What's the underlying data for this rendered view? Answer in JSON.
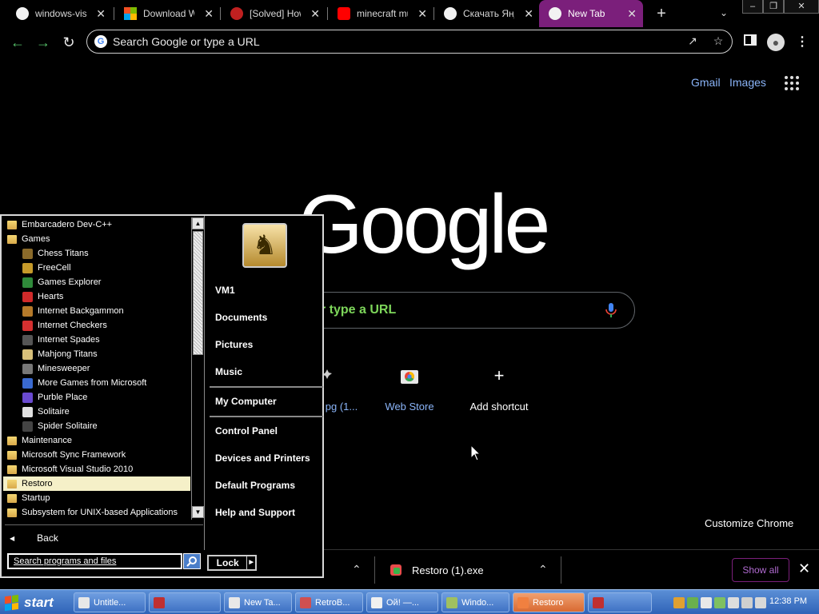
{
  "tabs": [
    {
      "label": "windows-vista",
      "favicon": "chrome-icon"
    },
    {
      "label": "Download Win",
      "favicon": "microsoft-icon"
    },
    {
      "label": "[Solved] How",
      "favicon": "bird-icon"
    },
    {
      "label": "minecraft mus",
      "favicon": "youtube-icon"
    },
    {
      "label": "Скачать Янде",
      "favicon": "chrome-icon"
    },
    {
      "label": "New Tab",
      "favicon": "chrome-icon",
      "active": true
    }
  ],
  "omnibox": {
    "placeholder": "Search Google or type a URL"
  },
  "ntp": {
    "gmail": "Gmail",
    "images": "Images",
    "logo": "Google",
    "search_text": "r type a URL",
    "shortcuts": [
      {
        "label": "pg (1...",
        "icon": "puzzle-icon"
      },
      {
        "label": "Web Store",
        "icon": "web-store-icon"
      },
      {
        "label": "Add shortcut",
        "icon": "plus-icon"
      }
    ],
    "customize": "Customize Chrome"
  },
  "downloads": {
    "item": "Restoro (1).exe",
    "show_all": "Show all"
  },
  "start_menu": {
    "programs": [
      {
        "label": "Embarcadero Dev-C++",
        "kind": "folder",
        "level": 0
      },
      {
        "label": "Games",
        "kind": "folder",
        "level": 0
      },
      {
        "label": "Chess Titans",
        "kind": "app",
        "level": 1,
        "color": "#8a6a2a"
      },
      {
        "label": "FreeCell",
        "kind": "app",
        "level": 1,
        "color": "#c59a2a"
      },
      {
        "label": "Games Explorer",
        "kind": "app",
        "level": 1,
        "color": "#2f8a3a"
      },
      {
        "label": "Hearts",
        "kind": "app",
        "level": 1,
        "color": "#d02a2a"
      },
      {
        "label": "Internet Backgammon",
        "kind": "app",
        "level": 1,
        "color": "#b57a2a"
      },
      {
        "label": "Internet Checkers",
        "kind": "app",
        "level": 1,
        "color": "#d43030"
      },
      {
        "label": "Internet Spades",
        "kind": "app",
        "level": 1,
        "color": "#555555"
      },
      {
        "label": "Mahjong Titans",
        "kind": "app",
        "level": 1,
        "color": "#d8c07a"
      },
      {
        "label": "Minesweeper",
        "kind": "app",
        "level": 1,
        "color": "#777777"
      },
      {
        "label": "More Games from Microsoft",
        "kind": "app",
        "level": 1,
        "color": "#3a6ad0"
      },
      {
        "label": "Purble Place",
        "kind": "app",
        "level": 1,
        "color": "#6a4ad0"
      },
      {
        "label": "Solitaire",
        "kind": "app",
        "level": 1,
        "color": "#e0e0e0"
      },
      {
        "label": "Spider Solitaire",
        "kind": "app",
        "level": 1,
        "color": "#444444"
      },
      {
        "label": "Maintenance",
        "kind": "folder",
        "level": 0
      },
      {
        "label": "Microsoft Sync Framework",
        "kind": "folder",
        "level": 0
      },
      {
        "label": "Microsoft Visual Studio 2010",
        "kind": "folder",
        "level": 0
      },
      {
        "label": "Restoro",
        "kind": "folder",
        "level": 0,
        "selected": true
      },
      {
        "label": "Startup",
        "kind": "folder",
        "level": 0
      },
      {
        "label": "Subsystem for UNIX-based Applications",
        "kind": "folder",
        "level": 0
      }
    ],
    "back": "Back",
    "search_placeholder": "Search programs and files",
    "user": "VM1",
    "right_items": [
      {
        "label": "Documents",
        "group": 1
      },
      {
        "label": "Pictures",
        "group": 1
      },
      {
        "label": "Music",
        "group": 1
      },
      {
        "label": "My Computer",
        "group": 2
      },
      {
        "label": "Control Panel",
        "group": 3
      },
      {
        "label": "Devices and Printers",
        "group": 3
      },
      {
        "label": "Default Programs",
        "group": 3
      },
      {
        "label": "Help and Support",
        "group": 3
      }
    ],
    "lock": "Lock"
  },
  "taskbar": {
    "start": "start",
    "tasks": [
      {
        "label": "Untitle...",
        "icon_color": "#e8e8e8"
      },
      {
        "label": "",
        "icon_color": "#c03030"
      },
      {
        "label": "New Ta...",
        "icon_color": "#e8e8e8"
      },
      {
        "label": "RetroB...",
        "icon_color": "#d05050"
      },
      {
        "label": "Ой! —...",
        "icon_color": "#f0f0f0"
      },
      {
        "label": "Windo...",
        "icon_color": "#a0c060"
      },
      {
        "label": "Restoro",
        "icon_color": "#f08040",
        "active": true
      },
      {
        "label": "",
        "icon_color": "#c03030"
      }
    ],
    "clock": "12:38 PM"
  }
}
